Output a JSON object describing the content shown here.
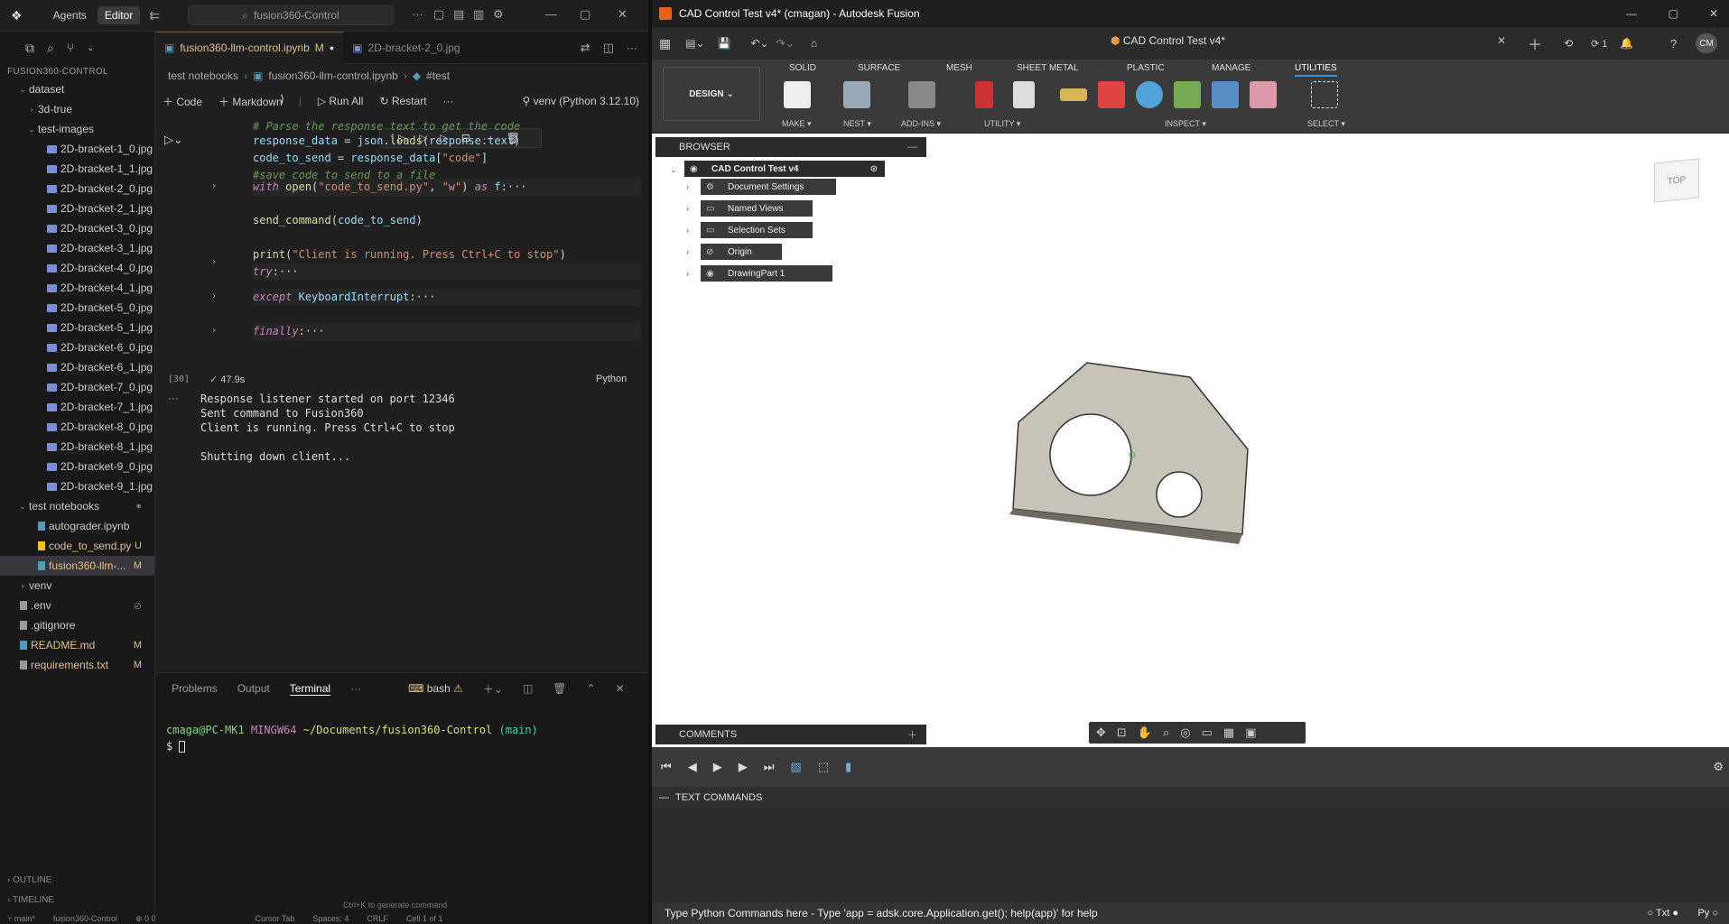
{
  "vscode": {
    "top_tabs": [
      "Agents",
      "Editor"
    ],
    "search_placeholder": "fusion360-Control",
    "explorer_title": "FUSION360-CONTROL",
    "tree": [
      {
        "label": "dataset",
        "level": 1,
        "chev": "⌄",
        "type": "folder"
      },
      {
        "label": "3d-true",
        "level": 2,
        "chev": "›",
        "type": "folder"
      },
      {
        "label": "test-images",
        "level": 2,
        "chev": "⌄",
        "type": "folder"
      },
      {
        "label": "2D-bracket-1_0.jpg",
        "level": 3,
        "type": "img"
      },
      {
        "label": "2D-bracket-1_1.jpg",
        "level": 3,
        "type": "img"
      },
      {
        "label": "2D-bracket-2_0.jpg",
        "level": 3,
        "type": "img"
      },
      {
        "label": "2D-bracket-2_1.jpg",
        "level": 3,
        "type": "img"
      },
      {
        "label": "2D-bracket-3_0.jpg",
        "level": 3,
        "type": "img"
      },
      {
        "label": "2D-bracket-3_1.jpg",
        "level": 3,
        "type": "img"
      },
      {
        "label": "2D-bracket-4_0.jpg",
        "level": 3,
        "type": "img"
      },
      {
        "label": "2D-bracket-4_1.jpg",
        "level": 3,
        "type": "img"
      },
      {
        "label": "2D-bracket-5_0.jpg",
        "level": 3,
        "type": "img"
      },
      {
        "label": "2D-bracket-5_1.jpg",
        "level": 3,
        "type": "img"
      },
      {
        "label": "2D-bracket-6_0.jpg",
        "level": 3,
        "type": "img"
      },
      {
        "label": "2D-bracket-6_1.jpg",
        "level": 3,
        "type": "img"
      },
      {
        "label": "2D-bracket-7_0.jpg",
        "level": 3,
        "type": "img"
      },
      {
        "label": "2D-bracket-7_1.jpg",
        "level": 3,
        "type": "img"
      },
      {
        "label": "2D-bracket-8_0.jpg",
        "level": 3,
        "type": "img"
      },
      {
        "label": "2D-bracket-8_1.jpg",
        "level": 3,
        "type": "img"
      },
      {
        "label": "2D-bracket-9_0.jpg",
        "level": 3,
        "type": "img"
      },
      {
        "label": "2D-bracket-9_1.jpg",
        "level": 3,
        "type": "img"
      },
      {
        "label": "test notebooks",
        "level": 1,
        "chev": "⌄",
        "type": "folder",
        "badge": "●"
      },
      {
        "label": "autograder.ipynb",
        "level": 2,
        "type": "nb"
      },
      {
        "label": "code_to_send.py",
        "level": 2,
        "type": "py",
        "badge": "U"
      },
      {
        "label": "fusion360-llm-...",
        "level": 2,
        "type": "nb",
        "badge": "M",
        "selected": true
      },
      {
        "label": "venv",
        "level": 1,
        "chev": "›",
        "type": "folder"
      },
      {
        "label": ".env",
        "level": 0,
        "type": "gear",
        "badge": "⊘"
      },
      {
        "label": ".gitignore",
        "level": 0,
        "type": "git"
      },
      {
        "label": "README.md",
        "level": 0,
        "type": "info",
        "badge": "M"
      },
      {
        "label": "requirements.txt",
        "level": 0,
        "type": "txt",
        "badge": "M"
      }
    ],
    "outline_label": "OUTLINE",
    "timeline_label": "TIMELINE",
    "editor_tabs": [
      {
        "label": "fusion360-llm-control.ipynb",
        "suffix": "M",
        "active": true
      },
      {
        "label": "2D-bracket-2_0.jpg",
        "active": false
      }
    ],
    "breadcrumb": [
      "test notebooks",
      "fusion360-llm-control.ipynb",
      "#test"
    ],
    "nb_toolbar": {
      "code": "Code",
      "markdown": "Markdown",
      "run_all": "Run All",
      "restart": "Restart",
      "kernel": "venv (Python 3.12.10)"
    },
    "cell_index": "[30]",
    "exec_time": "47.9s",
    "cell_lang": "Python",
    "output_lines": [
      "Response listener started on port 12346",
      "Sent command to Fusion360",
      "Client is running. Press Ctrl+C to stop",
      "",
      "Shutting down client..."
    ],
    "panel_tabs": [
      "Problems",
      "Output",
      "Terminal"
    ],
    "terminal_shell": "bash",
    "terminal_prompt_user": "cmaga@PC-MK1",
    "terminal_prompt_env": "MINGW64",
    "terminal_prompt_path": "~/Documents/fusion360-Control",
    "terminal_prompt_branch": "(main)",
    "terminal_hint": "Ctrl+K to generate command",
    "status": {
      "branch": "main*",
      "folder": "fusion360-Control",
      "errors": "0 0",
      "cursor_tab": "Cursor Tab",
      "spaces": "Spaces: 4",
      "eol": "CRLF",
      "cell": "Cell 1 of 1"
    }
  },
  "fusion": {
    "window_title": "CAD Control Test v4* (cmagan) - Autodesk Fusion",
    "doc_tab": "CAD Control Test v4*",
    "notif_count": "1",
    "user_initials": "CM",
    "design_label": "DESIGN",
    "ribbon_tabs": [
      "SOLID",
      "SURFACE",
      "MESH",
      "SHEET METAL",
      "PLASTIC",
      "MANAGE",
      "UTILITIES"
    ],
    "ribbon_groups": [
      "MAKE",
      "NEST",
      "ADD-INS",
      "UTILITY",
      "INSPECT",
      "SELECT"
    ],
    "browser_title": "BROWSER",
    "browser_root": "CAD Control Test v4",
    "browser_nodes": [
      "Document Settings",
      "Named Views",
      "Selection Sets",
      "Origin",
      "DrawingPart 1"
    ],
    "viewcube_label": "TOP",
    "comments_title": "COMMENTS",
    "text_commands_title": "TEXT COMMANDS",
    "text_commands_hint": "Type Python Commands here - Type 'app = adsk.core.Application.get(); help(app)' for help",
    "text_modes": [
      "Txt",
      "Py"
    ],
    "colors": {
      "ribbon_bg": "#3a3a3a",
      "accent": "#3b94d9",
      "part_fill": "#c8c3b8"
    }
  }
}
